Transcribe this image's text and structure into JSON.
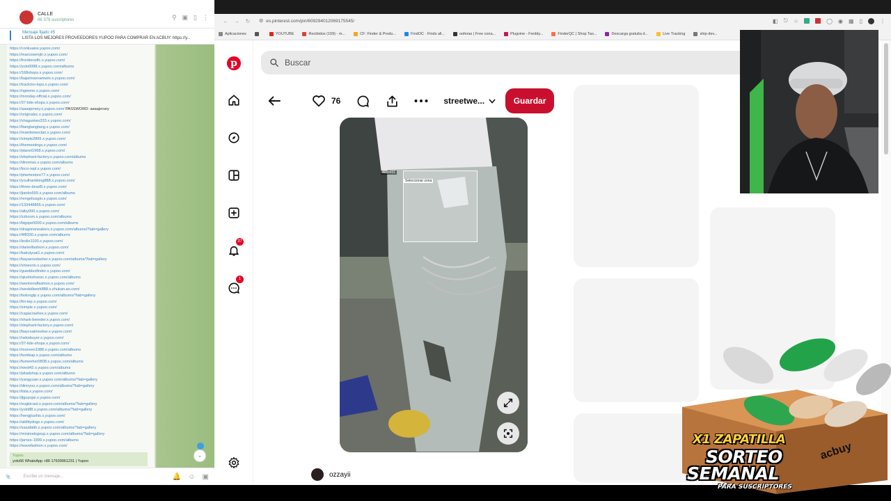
{
  "chat": {
    "title": "CALLE",
    "subtitle": "86 379 suscriptores",
    "pinned_title": "Mensaje fijado #5",
    "pinned_text": "LISTA LOS MEJORES PROVEEDORES YUPOO PARA COMPRAR EN ACBUY: https://y...",
    "links": [
      "https://conkuaiss.yupoo.com/",
      "https://marcowenjin.x.yupoo.com/",
      "https://frontiersdfc.x.yupoo.com/",
      "https://yolo0088.x.yupoo.com/albums",
      "https://168shops.x.yupoo.com/",
      "https://bajarinsenamwin.x.yupoo.com/",
      "https://trackmo-tops.x.yupoo.com/",
      "https://ngwone.x.yupoo.com/",
      "https://monday-offcial.x.yupoo.com/",
      "https://37-tide-shops.x.yupoo.com/",
      "https://aaaajersey.x.yupoo.com/",
      "https://originalsc.x.yupoo.com/",
      "https://shaguoiwu333.x.yupoo.com/",
      "https://ttangtangtang.x.yupoo.com/",
      "https://mainbowsclan.x.yupoo.com/",
      "https://simple2899.x.yupoo.com/",
      "https://themeetings.x.yupoo.com/",
      "https://planet1968.x.yupoo.com/",
      "https://elephant-factory.x.yupoo.com/albums",
      "https://dinomax.x.yupoo.com/albums",
      "https://loco-repl.x.yupoo.com/",
      "https://phertestore77.x.yupoo.com/",
      "https://youlhankking888.x.yupoo.com/",
      "https://three-dead9.x.yupoo.com/",
      "https://jianbo555.x.yupoo.com/albums",
      "https://rengeliusgin.x.yupoo.com/",
      "https://133448855.x.yupoo.com/",
      "https://alby000.x.yupoo.com/",
      "https://zzbcom.x.yupoo.com/albums",
      "https://bigspe0000.x.yupoo.com/albums",
      "https://dragonsneakers.x.yupoo.com/albums/?tab=gallery",
      "https://4f8330.x.yupoo.com/albums",
      "https://leslie1100.x.yupoo.com/",
      "https://danielfashion.x.yupoo.com/",
      "https://kairuiyuai1.x.yupoo.com/",
      "https://bayaessdasher.x.yupoo.com/albums/?tab=gallery",
      "https://shoesrio.x.yupoo.com/",
      "https://gueddesfinder.x.yupoo.com/",
      "https://qiuxhishoesc.x.yupoo.com/albums",
      "https://wentrendfashion.x.yupoo.com/",
      "https://weskdlwork888.x.zhukan.ao.com/",
      "https://bolongtp.x.yupoo.com/albums/?tab=gallery",
      "https://fm-tep.x.yupoo.com/",
      "https://simple.x.yupoo.com/",
      "https://capacrashes.x.yupoo.com/",
      "https://shark-breeder.x.yupoo.com/",
      "https://elephant-factory.x.yupoo.com/",
      "https://baycoatmosker.x.yupoo.com/",
      "https://nekebuyer.x.yupoo.com/",
      "https://37-tide-shops.x.yupoo.com/",
      "https://monven1988.x.yupoo.com/albums",
      "https://tumikap.x.yupoo.com/albums",
      "https://fumenher0808.x.yupoo.com/albums",
      "https://west42.x.yupoo.com/albums",
      "https://pitadshop.x.yupoo.com/albums",
      "https://yangyuan.x.yupoo.com/albums/?tab=gallery",
      "https://dinnyou.x.yupoo.com/albums/?tab=gallery",
      "https://tisla.x.yupoo.com/",
      "https://jlguyope.x.yupoo.com/",
      "https://eugkicast.x.yupoo.com/albums/?tab=gallery",
      "https://yolo88.x.yupoo.com/albums/?tab=gallery",
      "https://hengjiushis.x.yupoo.com/",
      "https://abilitydogs.x.yupoo.com/",
      "https://sasafaith.x.yupoo.com/albums/?tab=gallery",
      "https://minimelsgoup.x.yupoo.com/albums/?tab=gallery",
      "https://james-1999.x.yupoo.com/albums",
      "https://wavefashion.x.yupoo.com/"
    ],
    "password_label": "PASSWORD: aaaajersey",
    "reply_title": "Yupoo",
    "reply_text": "yolo66 WhatsApp +86 17639961231 | Yupoo",
    "input_placeholder": "Escribe un mensaje..."
  },
  "browser": {
    "url": "es.pinterest.com/pin/609294012069175545/",
    "bookmarks": [
      {
        "label": "Aplicaciones",
        "color": "#888888"
      },
      {
        "label": "",
        "color": "#555555"
      },
      {
        "label": "YOUTUBE",
        "color": "#e62117"
      },
      {
        "label": "Recibidos (109) - m...",
        "color": "#d44638"
      },
      {
        "label": "CF: Finder & Produ...",
        "color": "#f5a623"
      },
      {
        "label": "FindOC · Finds all...",
        "color": "#1e88e5"
      },
      {
        "label": "ooferas | Free cona...",
        "color": "#333333"
      },
      {
        "label": "Plugvine - Freddy...",
        "color": "#c2185b"
      },
      {
        "label": "FinderQC | Shop Tao...",
        "color": "#ff7043"
      },
      {
        "label": "Descarga gratuita d...",
        "color": "#8e24aa"
      },
      {
        "label": "Live Tracking",
        "color": "#fbc02d"
      },
      {
        "label": "ship-dev...",
        "color": "#777777"
      }
    ]
  },
  "pinterest": {
    "search_placeholder": "Buscar",
    "likes": "76",
    "board_name": "streetwe...",
    "save_label": "Guardar",
    "notifications_badge": "37",
    "messages_badge": "1",
    "author": "ozzayii",
    "selection_size": "403x431",
    "selection_tip": "Seleccionar zona"
  },
  "promo": {
    "line1": "X1 ZAPATILLA",
    "line2": "SORTEO",
    "line3": "SEMANAL",
    "line4": "PARA SUSCRIPTORES",
    "brand": "acbuy",
    "accent": "#ffd23a"
  },
  "colors": {
    "pinterest_red": "#e60023",
    "save_red": "#c8102e",
    "link_blue": "#3b82c4"
  }
}
